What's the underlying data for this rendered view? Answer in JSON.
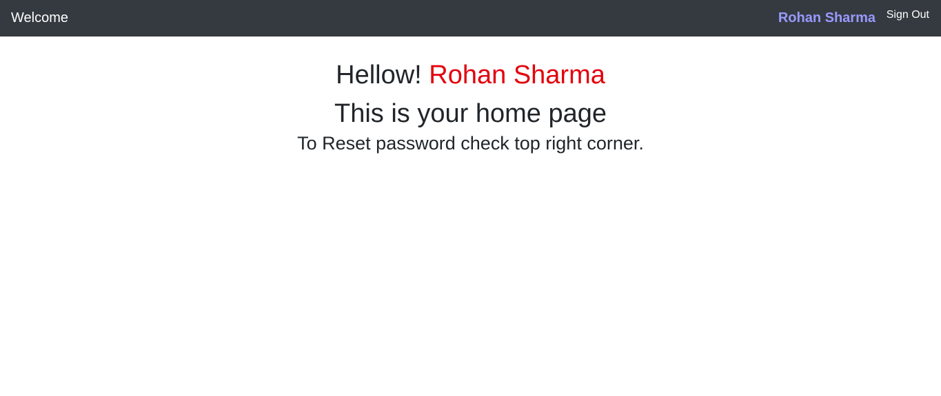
{
  "navbar": {
    "brand_label": "Welcome",
    "user_name": "Rohan Sharma",
    "sign_out_label": "Sign Out"
  },
  "main": {
    "greeting_prefix": "Hellow! ",
    "greeting_name": "Rohan Sharma",
    "home_text": "This is your home page",
    "reset_text": "To Reset password check top right corner."
  },
  "colors": {
    "navbar_bg": "#343a40",
    "user_name": "#9999ff",
    "greeting_name": "#e3000b",
    "text": "#212529"
  }
}
